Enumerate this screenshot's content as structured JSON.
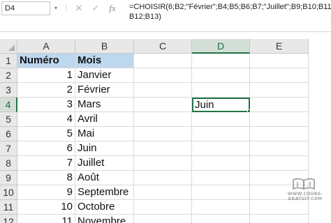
{
  "formula_bar": {
    "name_box": "D4",
    "name_box_arrow": "▾",
    "cancel_icon": "✕",
    "enter_icon": "✓",
    "function_icon": "fx",
    "formula_line1": "=CHOISIR(6;B2;\"Février\";B4;B5;B6;B7;\"Juillet\";B9;B10;B11;",
    "formula_line2": "B12;B13)"
  },
  "columns": [
    "A",
    "B",
    "C",
    "D",
    "E"
  ],
  "selected_column": "D",
  "rows": [
    "1",
    "2",
    "3",
    "4",
    "5",
    "6",
    "7",
    "8",
    "9",
    "10",
    "11",
    "12"
  ],
  "selected_row": "4",
  "cells": {
    "A1": "Numéro",
    "B1": "Mois",
    "A2": "1",
    "B2": "Janvier",
    "A3": "2",
    "B3": "Février",
    "A4": "3",
    "B4": "Mars",
    "A5": "4",
    "B5": "Avril",
    "A6": "5",
    "B6": "Mai",
    "A7": "6",
    "B7": "Juin",
    "A8": "7",
    "B8": "Juillet",
    "A9": "8",
    "B9": "Août",
    "A10": "9",
    "B10": "Septembre",
    "A11": "10",
    "B11": "Octobre",
    "A12": "11",
    "B12": "Novembre",
    "D4": "Juin"
  },
  "header_fill_color": "#bdd7ee",
  "active_cell_border_color": "#217346",
  "watermark": {
    "text": "WWW.COURS-GRATUIT.COM",
    "icon": "book-icon"
  }
}
